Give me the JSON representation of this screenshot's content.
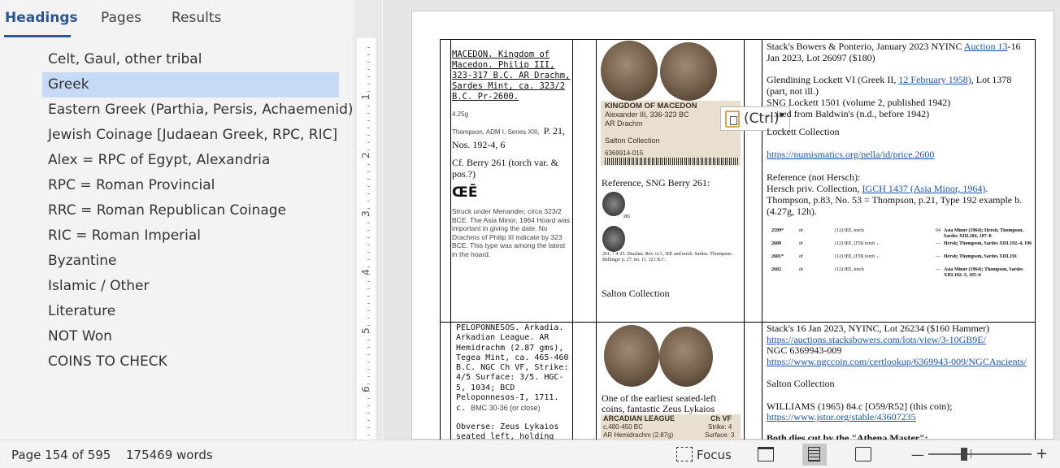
{
  "nav": {
    "tabs": [
      "Headings",
      "Pages",
      "Results"
    ],
    "headings": [
      "Celt, Gaul, other tribal",
      "Greek",
      "Eastern Greek (Parthia, Persis, Achaemenid)",
      "Jewish Coinage [Judaean Greek, RPC, RIC]",
      "Alex = RPC of Egypt, Alexandria",
      "RPC = Roman Provincial",
      "RRC = Roman Republican Coinage",
      "RIC = Roman Imperial",
      "Byzantine",
      "Islamic / Other",
      "Literature",
      "NOT Won",
      "COINS TO CHECK"
    ],
    "selected_index": 1
  },
  "ruler": {
    "numbers": [
      "1",
      "2",
      "3",
      "4",
      "5",
      "6"
    ]
  },
  "row1": {
    "col1": {
      "title": "MACEDON. Kingdom of Macedon. Philip III, 323-317 B.C. AR Drachm, Sardes Mint, ca. 323/2 B.C. Pr-2600.",
      "weight": "4.25g",
      "ref_small": "Thompson, ADM I, Series XIII,",
      "ref_tail": "P. 21, Nos. 192-4, 6",
      "cf": "Cf. Berry 261 (torch var. & pos.?)",
      "mono_glyph": "ŒĒ",
      "note": "Struck under Menander, circa 323/2 BCE. The Asia Minor, 1964 Hoard was important in giving the date. No Drachms of Philip III indicate by 323 BCE. This type was among the latest in the hoard."
    },
    "col2": {
      "slab_title": "KINGDOM OF MACEDON",
      "slab_line1": "Alexander III, 336-323 BC",
      "slab_line2": "AR Drachm",
      "slab_coll": "Salton Collection",
      "slab_id": "6369914-015",
      "reference": "Reference, SNG Berry 261:",
      "plate_num": "261",
      "plate_caption": "261.  ↑ 4·25. Drachm. Rev. to l., ŒĒ and torch. Sardes. Thompson-Bellinger p. 27, no. 11. 321 B.C.",
      "collection": "Salton Collection"
    },
    "col3": {
      "line1": "Stack's Bowers & Ponterio, January 2023 NYINC",
      "line1_link": "Auction 13",
      "line1_tail": "-16 Jan 2023, Lot 26097 ($180)",
      "glend": "Glendining Lockett VI (Greek II,",
      "glend_link": "12 February 1958)",
      "glend_tail": ", Lot 1378 (part, not ill.)",
      "sng": "SNG Lockett 1501 (volume 2, published 1942)",
      "acq": "…ired from Baldwin's (n.d., before 1942)",
      "lockett": "Lockett Collection",
      "pella": "https://numismatics.org/pella/id/price.2600",
      "ref_head": "Reference (not Hersch):",
      "hersch": "Hersch priv. Collection,",
      "igch": "IGCH 1437 (Asia Minor, 1964)",
      "thompson": "Thompson, p.83, No. 53 = Thompson, p.21, Type 192 example b. (4.27g, 12h).",
      "table_rows": [
        [
          "2599*",
          "dr",
          "(12) ŒĒ, torch",
          "94",
          "Asia Minor (1964); Hersh; Thompson, Sardes XIII.184, 187–8"
        ],
        [
          "2600",
          "dr",
          "(12) ŒĒ, (ΓΗ) torch ←",
          "—",
          "Hersh; Thompson, Sardes XIII.192–4, 196"
        ],
        [
          "2601*",
          "dr",
          "(12) ŒĒ, (ΓΗ) torch ←",
          "—",
          "Hersh; Thompson, Sardes XIII.191"
        ],
        [
          "2602",
          "dr",
          "(12) ŒĒ, torch",
          "—",
          "Asia Minor (1964); Thompson, Sardes XIII.182–3, 185–6"
        ]
      ]
    }
  },
  "row2": {
    "col1": {
      "text": "PELOPONNESOS. Arkadia. Arkadian League. AR Hemidrachm (2.87 gms), Tegea Mint, ca. 465-460 B.C. NGC Ch VF, Strike: 4/5 Surface: 3/5. HGC-5, 1034; BCD Peloponnesos-I, 1711.",
      "c_line": "c.",
      "bmc": "BMC 30-36 (or close)",
      "obverse": "Obverse: Zeus Lykaios seated left, holding scepter"
    },
    "col2": {
      "caption": "One of the earliest seated-left coins, fantastic Zeus Lykaios",
      "slab_title": "ARCADIAN LEAGUE",
      "slab_grade": "Ch VF",
      "slab_line1": "c.480-450 BC",
      "slab_strike": "Strike: 4",
      "slab_line2": "AR Hemidrachm (2.87g)",
      "slab_surface": "Surface: 3"
    },
    "col3": {
      "stacks": "Stack's 16 Jan 2023, NYINC, Lot 26234 ($160 Hammer)",
      "stacks_link": "https://auctions.stacksbowers.com/lots/view/3-10GB9E/",
      "ngc": "NGC 6369943-009",
      "ngc_link": "https://www.ngccoin.com/certlookup/6369943-009/NGCAncients/",
      "salton": "Salton Collection",
      "williams": "WILLIAMS (1965) 84.c [O59/R52] (this coin);",
      "jstor": "https://www.jstor.org/stable/43607235",
      "cut": "Both dies cut by the \"Athena Master\":"
    }
  },
  "paste_options": {
    "label": "(Ctrl)"
  },
  "status": {
    "page": "Page 154 of 595",
    "words": "175469 words",
    "focus": "Focus",
    "zoom_percent": 35
  },
  "colors": {
    "accent": "#2b579a",
    "selection": "#c7daf5",
    "link": "#1a54b5"
  }
}
